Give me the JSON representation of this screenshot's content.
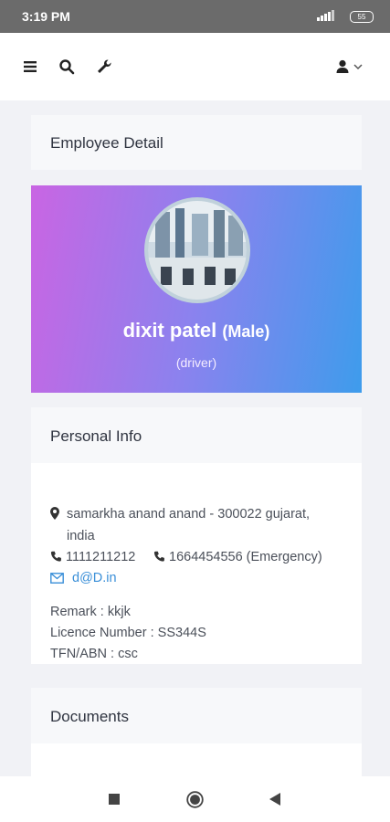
{
  "status_bar": {
    "time": "3:19 PM",
    "battery": "55"
  },
  "header": {
    "section_title": "Employee Detail"
  },
  "profile": {
    "name": "dixit patel",
    "gender": "(Male)",
    "role": "(driver)"
  },
  "personal_info": {
    "title": "Personal Info",
    "address_line1": "samarkha anand anand - 300022 gujarat,",
    "address_line2": "india",
    "phone": "1111211212",
    "emergency_phone": "1664454556 (Emergency)",
    "email": "d@D.in",
    "remark": "Remark : kkjk",
    "licence": "Licence Number : SS344S",
    "tfn": "TFN/ABN : csc"
  },
  "documents": {
    "title": "Documents"
  },
  "colors": {
    "gradient_start": "#c965e3",
    "gradient_end": "#3e9cec",
    "link": "#3a8fd8"
  }
}
